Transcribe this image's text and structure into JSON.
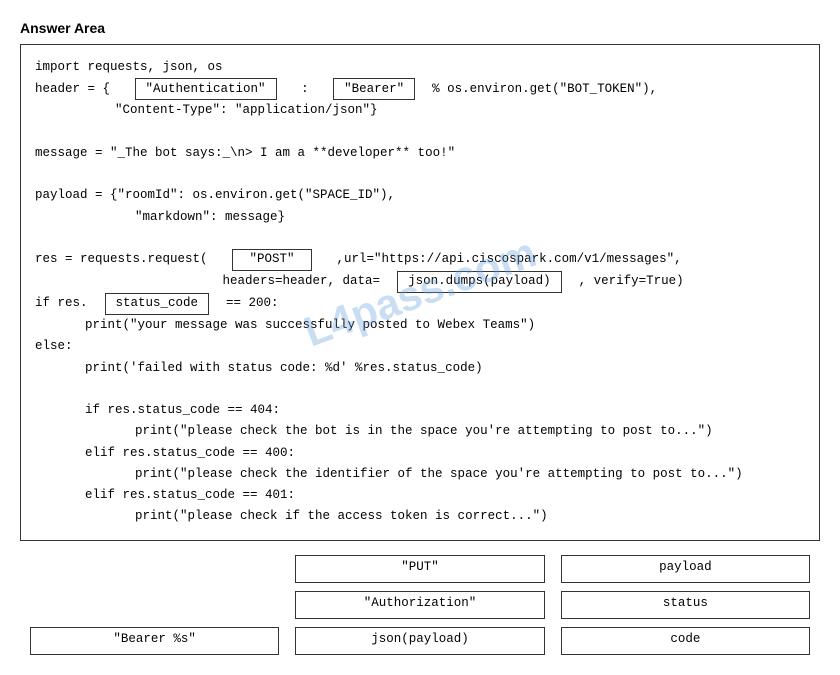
{
  "page": {
    "title": "Answer Area"
  },
  "watermark": "L4pass.com",
  "code": {
    "line1": "import requests, json, os",
    "line2_pre": "header = {   ",
    "box_authentication": "\"Authentication\"",
    "line2_colon": "   :   ",
    "box_bearer": "\"Bearer\"",
    "line2_post": "  % os.environ.get(\"BOT_TOKEN\"),",
    "line3": "        \"Content-Type\": \"application/json\"}",
    "line4": "",
    "line5": "message = \"_The bot says:_\\n> I am a **developer** too!\"",
    "line6": "",
    "line7": "payload = {\"roomId\": os.environ.get(\"SPACE_ID\"),",
    "line8": "        \"markdown\": message}",
    "line9": "",
    "line10_pre": "res = requests.request(   ",
    "box_post": "\"POST\"",
    "line10_post": "   ,url=\"https://api.ciscospark.com/v1/messages\",",
    "line11_pre": "                         headers=header, data=  ",
    "box_json_dumps": "json.dumps(payload)",
    "line11_post": "  , verify=True)",
    "line12_pre": "if res.  ",
    "box_status_code": "status_code",
    "line12_post": "  == 200:",
    "line13": "    print(\"your message was successfully posted to Webex Teams\")",
    "line14": "else:",
    "line15": "    print('failed with status code: %d' %res.status_code)",
    "line16": "",
    "line17": "    if res.status_code == 404:",
    "line18": "        print(\"please check the bot is in the space you're attempting to post to...\")",
    "line19": "    elif res.status_code == 400:",
    "line20": "        print(\"please check the identifier of the space you're attempting to post to...\")",
    "line21": "    elif res.status_code == 401:",
    "line22": "        print(\"please check if the access token is correct...\")"
  },
  "options": [
    {
      "id": "opt1",
      "label": "\"PUT\"",
      "col": 2,
      "row": 1
    },
    {
      "id": "opt2",
      "label": "payload",
      "col": 3,
      "row": 1
    },
    {
      "id": "opt3",
      "label": "\"Authorization\"",
      "col": 2,
      "row": 2
    },
    {
      "id": "opt4",
      "label": "status",
      "col": 3,
      "row": 2
    },
    {
      "id": "opt5",
      "label": "\"Bearer %s\"",
      "col": 1,
      "row": 3
    },
    {
      "id": "opt6",
      "label": "json(payload)",
      "col": 2,
      "row": 3
    },
    {
      "id": "opt7",
      "label": "code",
      "col": 3,
      "row": 3
    }
  ]
}
